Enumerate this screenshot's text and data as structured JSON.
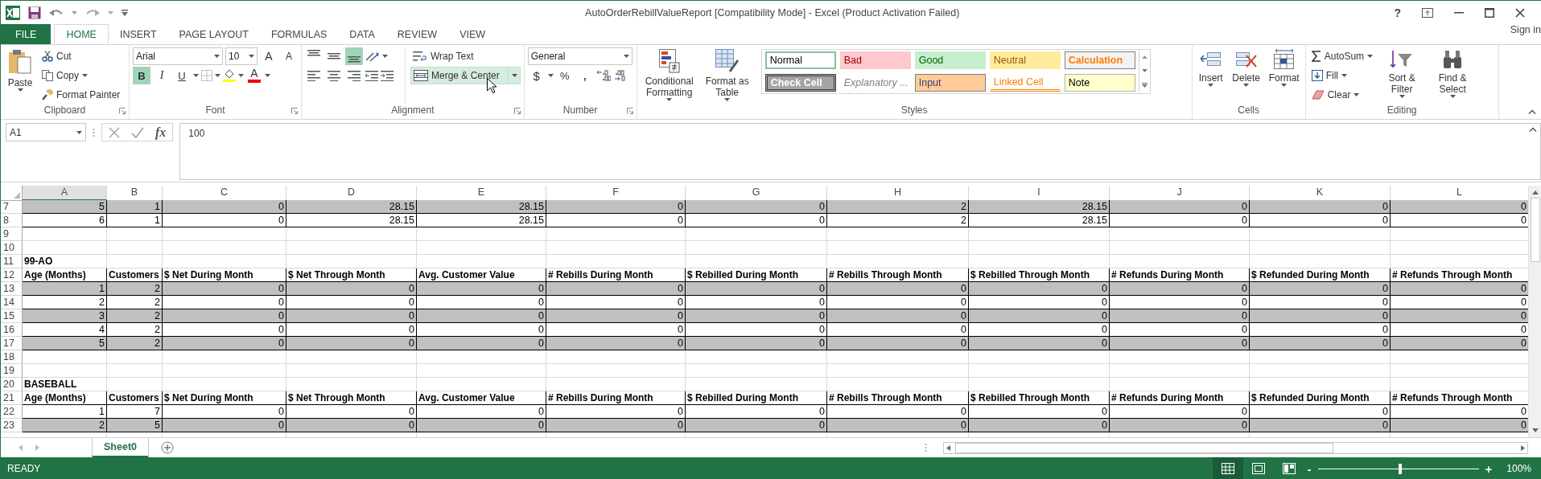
{
  "window": {
    "title": "AutoOrderRebillValueReport  [Compatibility Mode] - Excel (Product Activation Failed)",
    "help": "?",
    "account": "Sign in"
  },
  "ribbon_tabs": [
    {
      "label": "FILE",
      "kind": "file",
      "selected": false
    },
    {
      "label": "HOME",
      "kind": "tab",
      "selected": true
    },
    {
      "label": "INSERT",
      "kind": "tab",
      "selected": false
    },
    {
      "label": "PAGE LAYOUT",
      "kind": "tab",
      "selected": false
    },
    {
      "label": "FORMULAS",
      "kind": "tab",
      "selected": false
    },
    {
      "label": "DATA",
      "kind": "tab",
      "selected": false
    },
    {
      "label": "REVIEW",
      "kind": "tab",
      "selected": false
    },
    {
      "label": "VIEW",
      "kind": "tab",
      "selected": false
    }
  ],
  "clipboard": {
    "label": "Clipboard",
    "paste": "Paste",
    "cut": "Cut",
    "copy": "Copy",
    "format_painter": "Format Painter"
  },
  "font": {
    "label": "Font",
    "name": "Arial",
    "size": "10",
    "grow": "A",
    "shrink": "A",
    "bold": {
      "label": "B",
      "selected": true
    },
    "italic": {
      "label": "I",
      "selected": false
    },
    "underline": {
      "label": "U",
      "selected": false
    },
    "font_color": "A"
  },
  "alignment": {
    "label": "Alignment",
    "vertical": [
      {
        "selected": false
      },
      {
        "selected": false
      },
      {
        "selected": true
      }
    ],
    "horizontal": [
      {
        "selected": false
      },
      {
        "selected": false
      },
      {
        "selected": false
      }
    ],
    "wrap_text": "Wrap Text",
    "merge_center": {
      "label": "Merge & Center",
      "hovered": true
    }
  },
  "number": {
    "label": "Number",
    "format": "General",
    "currency": "$",
    "percent": "%",
    "comma": ","
  },
  "styles": {
    "label": "Styles",
    "conditional_formatting": "Conditional Formatting",
    "format_as_table": "Format as Table",
    "gallery": [
      {
        "label": "Normal",
        "kind": "normal",
        "selected": true
      },
      {
        "label": "Bad",
        "kind": "bad",
        "selected": false
      },
      {
        "label": "Good",
        "kind": "good",
        "selected": false
      },
      {
        "label": "Neutral",
        "kind": "neutral",
        "selected": false
      },
      {
        "label": "Calculation",
        "kind": "calculation",
        "selected": false
      },
      {
        "label": "Check Cell",
        "kind": "check",
        "selected": false
      },
      {
        "label": "Explanatory ...",
        "kind": "explanatory",
        "selected": false
      },
      {
        "label": "Input",
        "kind": "input",
        "selected": false
      },
      {
        "label": "Linked Cell",
        "kind": "linked",
        "selected": false
      },
      {
        "label": "Note",
        "kind": "note",
        "selected": false
      }
    ]
  },
  "cells": {
    "label": "Cells",
    "insert": "Insert",
    "delete": "Delete",
    "format": "Format"
  },
  "editing": {
    "label": "Editing",
    "autosum": "AutoSum",
    "fill": "Fill",
    "clear": "Clear",
    "sort_filter": "Sort & Filter",
    "find_select": "Find & Select"
  },
  "formula_bar": {
    "name_box": "A1",
    "fx": "fx",
    "value": "100"
  },
  "sheet": {
    "columns": [
      {
        "label": "A",
        "selected": true
      },
      {
        "label": "B",
        "selected": false
      },
      {
        "label": "C",
        "selected": false
      },
      {
        "label": "D",
        "selected": false
      },
      {
        "label": "E",
        "selected": false
      },
      {
        "label": "F",
        "selected": false
      },
      {
        "label": "G",
        "selected": false
      },
      {
        "label": "H",
        "selected": false
      },
      {
        "label": "I",
        "selected": false
      },
      {
        "label": "J",
        "selected": false
      },
      {
        "label": "K",
        "selected": false
      },
      {
        "label": "L",
        "selected": false
      }
    ],
    "rows": [
      {
        "number": "7",
        "kind": "data",
        "shaded": true,
        "cells": [
          "5",
          "1",
          "0",
          "28.15",
          "28.15",
          "0",
          "0",
          "2",
          "28.15",
          "0",
          "0",
          "0"
        ]
      },
      {
        "number": "8",
        "kind": "data",
        "shaded": false,
        "cells": [
          "6",
          "1",
          "0",
          "28.15",
          "28.15",
          "0",
          "0",
          "2",
          "28.15",
          "0",
          "0",
          "0"
        ]
      },
      {
        "number": "9",
        "kind": "blank"
      },
      {
        "number": "10",
        "kind": "blank"
      },
      {
        "number": "11",
        "kind": "title",
        "cells": [
          "99-AO"
        ]
      },
      {
        "number": "12",
        "kind": "header",
        "cells": [
          "Age (Months)",
          "Customers",
          "$ Net During Month",
          "$ Net Through Month",
          "Avg. Customer Value",
          "# Rebills During Month",
          "$ Rebilled During Month",
          "# Rebills Through Month",
          "$ Rebilled Through Month",
          "# Refunds During Month",
          "$ Refunded During Month",
          "# Refunds Through Month"
        ]
      },
      {
        "number": "13",
        "kind": "data",
        "shaded": true,
        "cells": [
          "1",
          "2",
          "0",
          "0",
          "0",
          "0",
          "0",
          "0",
          "0",
          "0",
          "0",
          "0"
        ]
      },
      {
        "number": "14",
        "kind": "data",
        "shaded": false,
        "cells": [
          "2",
          "2",
          "0",
          "0",
          "0",
          "0",
          "0",
          "0",
          "0",
          "0",
          "0",
          "0"
        ]
      },
      {
        "number": "15",
        "kind": "data",
        "shaded": true,
        "cells": [
          "3",
          "2",
          "0",
          "0",
          "0",
          "0",
          "0",
          "0",
          "0",
          "0",
          "0",
          "0"
        ]
      },
      {
        "number": "16",
        "kind": "data",
        "shaded": false,
        "cells": [
          "4",
          "2",
          "0",
          "0",
          "0",
          "0",
          "0",
          "0",
          "0",
          "0",
          "0",
          "0"
        ]
      },
      {
        "number": "17",
        "kind": "data",
        "shaded": true,
        "cells": [
          "5",
          "2",
          "0",
          "0",
          "0",
          "0",
          "0",
          "0",
          "0",
          "0",
          "0",
          "0"
        ]
      },
      {
        "number": "18",
        "kind": "blank"
      },
      {
        "number": "19",
        "kind": "blank"
      },
      {
        "number": "20",
        "kind": "title",
        "cells": [
          "BASEBALL"
        ]
      },
      {
        "number": "21",
        "kind": "header",
        "cells": [
          "Age (Months)",
          "Customers",
          "$ Net During Month",
          "$ Net Through Month",
          "Avg. Customer Value",
          "# Rebills During Month",
          "$ Rebilled During Month",
          "# Rebills Through Month",
          "$ Rebilled Through Month",
          "# Refunds During Month",
          "$ Refunded During Month",
          "# Refunds Through Month"
        ]
      },
      {
        "number": "22",
        "kind": "data",
        "shaded": false,
        "cells": [
          "1",
          "7",
          "0",
          "0",
          "0",
          "0",
          "0",
          "0",
          "0",
          "0",
          "0",
          "0"
        ]
      },
      {
        "number": "23",
        "kind": "data",
        "shaded": true,
        "cells": [
          "2",
          "5",
          "0",
          "0",
          "0",
          "0",
          "0",
          "0",
          "0",
          "0",
          "0",
          "0"
        ]
      }
    ]
  },
  "sheet_tabs": [
    {
      "label": "Sheet0",
      "selected": true
    }
  ],
  "status_bar": {
    "status": "READY",
    "views": [
      {
        "kind": "normal",
        "selected": true
      },
      {
        "kind": "page_layout",
        "selected": false
      },
      {
        "kind": "page_break",
        "selected": false
      }
    ],
    "zoom_out": "-",
    "zoom_in": "+",
    "zoom": {
      "level": 0.5
    },
    "zoom_label": "100%"
  }
}
